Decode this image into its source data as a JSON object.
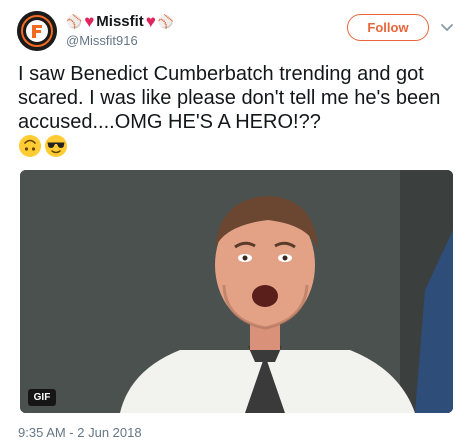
{
  "user": {
    "display_name": "Missfit",
    "handle": "@Missfit916",
    "name_emojis": [
      "baseball",
      "heart",
      "heart",
      "baseball"
    ]
  },
  "actions": {
    "follow_label": "Follow"
  },
  "tweet": {
    "text": "I saw Benedict Cumberbatch trending and got scared. I was like please don't tell me he's been accused....OMG HE'S A HERO!??",
    "emojis": [
      "upside-down-face",
      "sunglasses-face"
    ],
    "media_badge": "GIF",
    "timestamp": "9:35 AM - 2 Jun 2018"
  },
  "colors": {
    "follow_accent": "#e7663a",
    "heart": "#e0245e",
    "secondary_text": "#657786"
  }
}
